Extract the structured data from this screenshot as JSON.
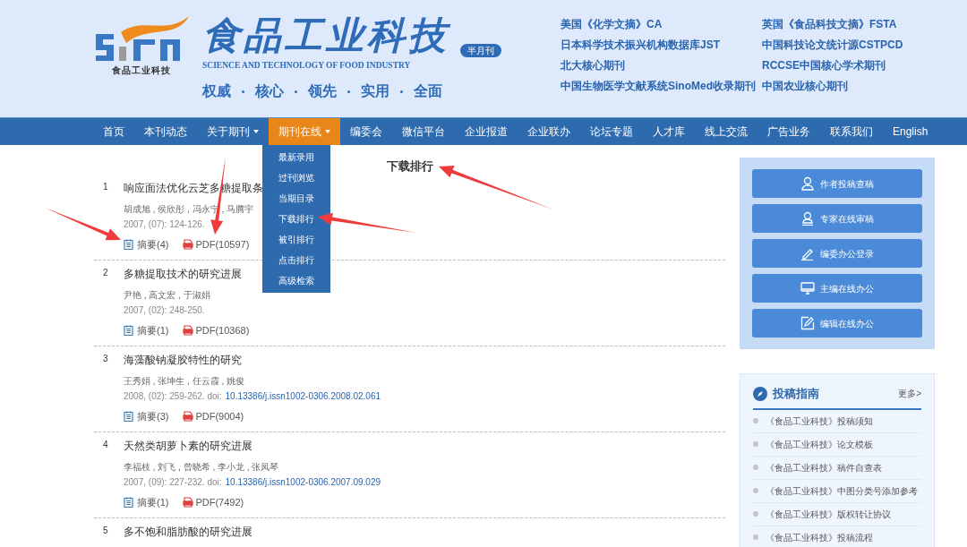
{
  "header": {
    "logo_caption": "食品工业科技",
    "title": "食品工业科技",
    "badge": "半月刊",
    "subtitle": "SCIENCE AND TECHNOLOGY OF FOOD INDUSTRY",
    "slogan": [
      "权威",
      "核心",
      "领先",
      "实用",
      "全面"
    ],
    "indexes": [
      "美国《化学文摘》CA",
      "英国《食品科技文摘》FSTA",
      "日本科学技术振兴机构数据库JST",
      "中国科技论文统计源CSTPCD",
      "北大核心期刊",
      "RCCSE中国核心学术期刊",
      "中国生物医学文献系统SinoMed收录期刊",
      "中国农业核心期刊"
    ]
  },
  "nav": [
    {
      "label": "首页",
      "selected": false,
      "dropdown": false
    },
    {
      "label": "本刊动态",
      "selected": false,
      "dropdown": false
    },
    {
      "label": "关于期刊",
      "selected": false,
      "dropdown": true
    },
    {
      "label": "期刊在线",
      "selected": true,
      "dropdown": true
    },
    {
      "label": "编委会",
      "selected": false,
      "dropdown": false
    },
    {
      "label": "微信平台",
      "selected": false,
      "dropdown": false
    },
    {
      "label": "企业报道",
      "selected": false,
      "dropdown": false
    },
    {
      "label": "企业联办",
      "selected": false,
      "dropdown": false
    },
    {
      "label": "论坛专题",
      "selected": false,
      "dropdown": false
    },
    {
      "label": "人才库",
      "selected": false,
      "dropdown": false
    },
    {
      "label": "线上交流",
      "selected": false,
      "dropdown": false
    },
    {
      "label": "广告业务",
      "selected": false,
      "dropdown": false
    },
    {
      "label": "联系我们",
      "selected": false,
      "dropdown": false
    },
    {
      "label": "English",
      "selected": false,
      "dropdown": false
    }
  ],
  "dropdown_menu": [
    "最新录用",
    "过刊浏览",
    "当期目录",
    "下载排行",
    "被引排行",
    "点击排行",
    "高级检索"
  ],
  "page_title": "下载排行",
  "articles": [
    {
      "number": "1",
      "title": "响应面法优化云芝多糖提取条",
      "authors": "胡成旭 , 侯欣彤 , 冯永宁 , 马腾宇",
      "citation": "2007, (07): 124-126.",
      "abstract": "摘要(4)",
      "pdf": "PDF(10597)"
    },
    {
      "number": "2",
      "title": "多糖提取技术的研究进展",
      "authors": "尹艳 , 高文宏 , 于淑娟",
      "citation": "2007, (02): 248-250.",
      "abstract": "摘要(1)",
      "pdf": "PDF(10368)"
    },
    {
      "number": "3",
      "title": "海藻酸钠凝胶特性的研究",
      "authors": "王秀娟 , 张坤生 , 任云霞 , 姚俊",
      "citation": "2008, (02): 259-262. doi:",
      "doi": "10.13386/j.issn1002-0306.2008.02.061",
      "abstract": "摘要(3)",
      "pdf": "PDF(9004)"
    },
    {
      "number": "4",
      "title": "天然类胡萝卜素的研究进展",
      "authors": "李福枝 , 刘飞 , 曾晓希 , 李小龙 , 张凤琴",
      "citation": "2007, (09): 227-232. doi:",
      "doi": "10.13386/j.issn1002-0306.2007.09.029",
      "abstract": "摘要(1)",
      "pdf": "PDF(7492)"
    },
    {
      "number": "5",
      "title": "多不饱和脂肪酸的研究进展"
    }
  ],
  "sidebar_buttons": [
    {
      "kind": "user",
      "label": "作者投稿查稿"
    },
    {
      "kind": "expert",
      "label": "专家在线审稿"
    },
    {
      "kind": "pen",
      "label": "编委办公登录"
    },
    {
      "kind": "monitor",
      "label": "主编在线办公"
    },
    {
      "kind": "edit",
      "label": "编辑在线办公"
    }
  ],
  "guide": {
    "title": "投稿指南",
    "more": "更多>",
    "items": [
      "《食品工业科技》投稿须知",
      "《食品工业科技》论文模板",
      "《食品工业科技》稿件自查表",
      "《食品工业科技》中图分类号添加参考",
      "《食品工业科技》版权转让协议",
      "《食品工业科技》投稿流程"
    ]
  }
}
